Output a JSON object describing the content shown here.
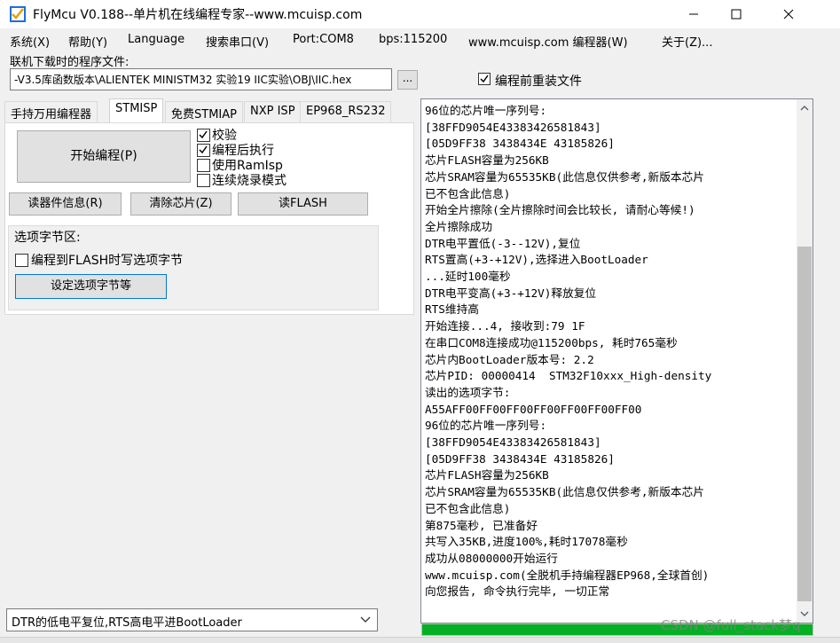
{
  "window": {
    "title": "FlyMcu V0.188--单片机在线编程专家--www.mcuisp.com"
  },
  "menu": {
    "items": [
      "系统(X)",
      "帮助(Y)",
      "Language",
      "搜索串口(V)",
      "Port:COM8",
      "bps:115200",
      "www.mcuisp.com 编程器(W)",
      "关于(Z)..."
    ]
  },
  "file": {
    "label": "联机下载时的程序文件:",
    "path": "-V3.5库函数版本\\ALIENTEK MINISTM32 实验19 IIC实验\\OBJ\\IIC.hex",
    "browse_label": "...",
    "reload_label": "编程前重装文件",
    "reload_checked": true
  },
  "tabs": [
    {
      "label": "手持万用编程器",
      "active": false
    },
    {
      "label": "STMISP",
      "active": true
    },
    {
      "label": "免费STMIAP",
      "active": false
    },
    {
      "label": "NXP ISP",
      "active": false
    },
    {
      "label": "EP968_RS232",
      "active": false
    }
  ],
  "stmisp": {
    "start_label": "开始编程(P)",
    "options": [
      {
        "label": "校验",
        "checked": true
      },
      {
        "label": "编程后执行",
        "checked": true
      },
      {
        "label": "使用RamIsp",
        "checked": false
      },
      {
        "label": "连续烧录模式",
        "checked": false
      }
    ],
    "read_info_label": "读器件信息(R)",
    "erase_label": "清除芯片(Z)",
    "read_flash_label": "读FLASH",
    "option_group": {
      "title": "选项字节区:",
      "flash_option_label": "编程到FLASH时写选项字节",
      "flash_option_checked": false,
      "set_button_label": "设定选项字节等"
    }
  },
  "reset_mode": {
    "value": "DTR的低电平复位,RTS高电平进BootLoader"
  },
  "log": {
    "lines": [
      "96位的芯片唯一序列号:",
      "[38FFD9054E43383426581843]",
      "[05D9FF38 3438434E 43185826]",
      "芯片FLASH容量为256KB",
      "芯片SRAM容量为65535KB(此信息仅供参考,新版本芯片",
      "已不包含此信息)",
      "开始全片擦除(全片擦除时间会比较长, 请耐心等候!)",
      "全片擦除成功",
      "DTR电平置低(-3--12V),复位",
      "RTS置高(+3-+12V),选择进入BootLoader",
      "...延时100毫秒",
      "DTR电平变高(+3-+12V)释放复位",
      "RTS维持高",
      "开始连接...4, 接收到:79 1F",
      "在串口COM8连接成功@115200bps, 耗时765毫秒",
      "芯片内BootLoader版本号: 2.2",
      "芯片PID: 00000414  STM32F10xxx_High-density",
      "读出的选项字节:",
      "A55AFF00FF00FF00FF00FF00FF00FF00",
      "96位的芯片唯一序列号:",
      "[38FFD9054E43383426581843]",
      "[05D9FF38 3438434E 43185826]",
      "芯片FLASH容量为256KB",
      "芯片SRAM容量为65535KB(此信息仅供参考,新版本芯片",
      "已不包含此信息)",
      "第875毫秒, 已准备好",
      "共写入35KB,进度100%,耗时17078毫秒",
      "成功从08000000开始运行",
      "www.mcuisp.com(全脱机手持编程器EP968,全球首创)",
      "向您报告, 命令执行完毕, 一切正常"
    ],
    "progress_percent": 100
  },
  "watermark": "CSDN @full_stack梦q",
  "colors": {
    "progress": "#06b025",
    "focus_border": "#0078d7"
  }
}
